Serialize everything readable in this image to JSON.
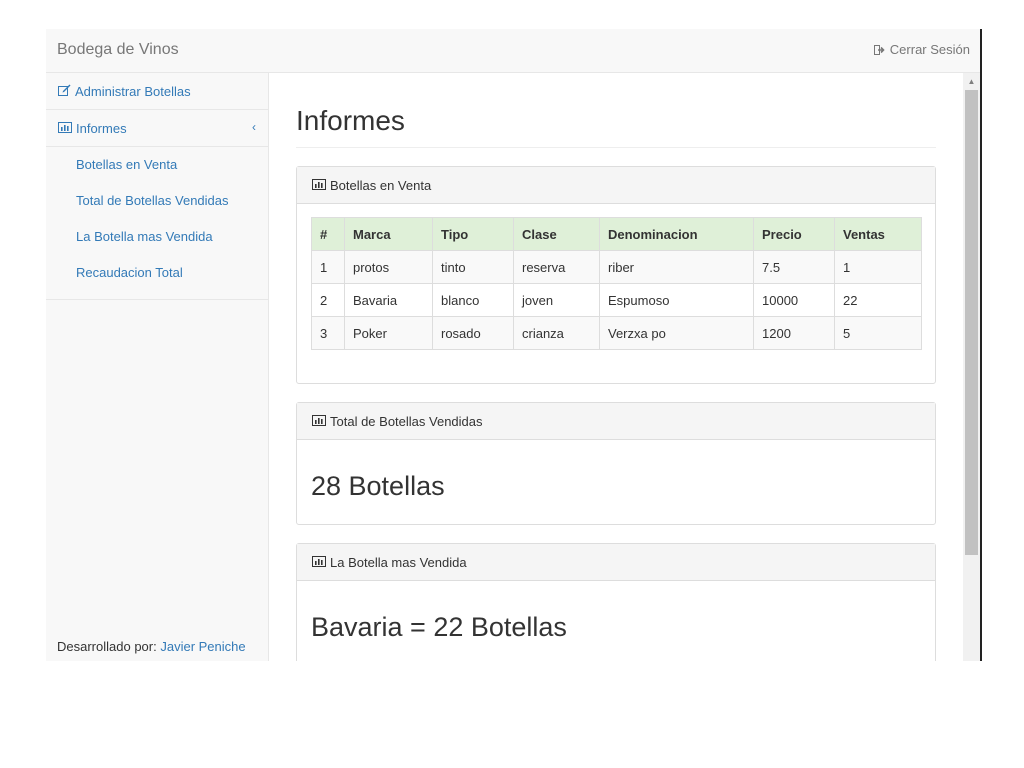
{
  "navbar": {
    "brand": "Bodega de Vinos",
    "logout_label": "Cerrar Sesión",
    "logout_icon": "sign-out-icon"
  },
  "sidebar": {
    "items": [
      {
        "label": "Administrar Botellas",
        "icon": "edit-icon"
      },
      {
        "label": "Informes",
        "icon": "bar-chart-icon",
        "chevron": "‹"
      }
    ],
    "subitems": [
      {
        "label": "Botellas en Venta"
      },
      {
        "label": "Total de Botellas Vendidas"
      },
      {
        "label": "La Botella mas Vendida"
      },
      {
        "label": "Recaudacion Total"
      }
    ],
    "footer": {
      "prefix": "Desarrollado por:",
      "author": "Javier Peniche"
    }
  },
  "main": {
    "title": "Informes",
    "panels": [
      {
        "heading": "Botellas en Venta",
        "icon": "bar-chart-icon",
        "table": {
          "headers": [
            "#",
            "Marca",
            "Tipo",
            "Clase",
            "Denominacion",
            "Precio",
            "Ventas"
          ],
          "rows": [
            [
              "1",
              "protos",
              "tinto",
              "reserva",
              "riber",
              "7.5",
              "1"
            ],
            [
              "2",
              "Bavaria",
              "blanco",
              "joven",
              "Espumoso",
              "10000",
              "22"
            ],
            [
              "3",
              "Poker",
              "rosado",
              "crianza",
              "Verzxa po",
              "1200",
              "5"
            ]
          ]
        }
      },
      {
        "heading": "Total de Botellas Vendidas",
        "icon": "bar-chart-icon",
        "value": "28 Botellas"
      },
      {
        "heading": "La Botella mas Vendida",
        "icon": "bar-chart-icon",
        "value": "Bavaria = 22 Botellas"
      }
    ]
  },
  "colors": {
    "link": "#337ab7",
    "table_header_bg": "#dff0d8",
    "navbar_bg": "#f8f8f8"
  }
}
